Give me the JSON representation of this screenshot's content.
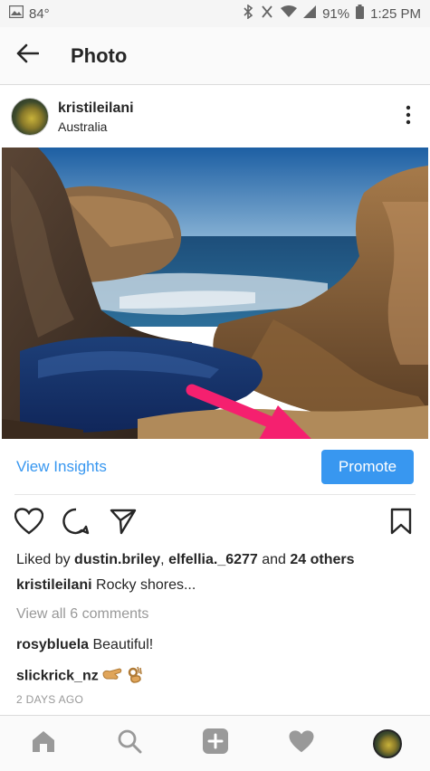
{
  "status_bar": {
    "temperature": "84°",
    "battery": "91%",
    "time": "1:25 PM",
    "icons": [
      "image-icon",
      "bluetooth-icon",
      "vibrate-icon",
      "wifi-icon",
      "signal-icon",
      "battery-icon"
    ]
  },
  "header": {
    "title": "Photo",
    "back_icon": "back-arrow-icon"
  },
  "post": {
    "username": "kristileilani",
    "location": "Australia",
    "more_icon": "more-options-icon",
    "photo_icon": "coastal-rocks-photo"
  },
  "insights": {
    "view_insights_label": "View Insights",
    "promote_label": "Promote",
    "arrow_color": "#f5206f"
  },
  "actions": {
    "icons": [
      "heart-icon",
      "comment-icon",
      "share-icon",
      "bookmark-icon"
    ]
  },
  "likes": {
    "prefix": "Liked by ",
    "user1": "dustin.briley",
    "separator": ", ",
    "user2": "elfellia._6277",
    "conj": " and ",
    "others": "24 others"
  },
  "caption": {
    "username": "kristileilani",
    "text": " Rocky shores..."
  },
  "view_comments": "View all 6 comments",
  "comments": [
    {
      "username": "rosybluela",
      "text": " Beautiful!"
    },
    {
      "username": "slickrick_nz",
      "text": ""
    }
  ],
  "timestamp": "2 DAYS AGO",
  "bottom_nav": {
    "icons": [
      "home-icon",
      "search-icon",
      "add-post-icon",
      "activity-heart-icon",
      "profile-avatar"
    ]
  },
  "colors": {
    "accent": "#3897f0",
    "arrow": "#f5206f"
  }
}
